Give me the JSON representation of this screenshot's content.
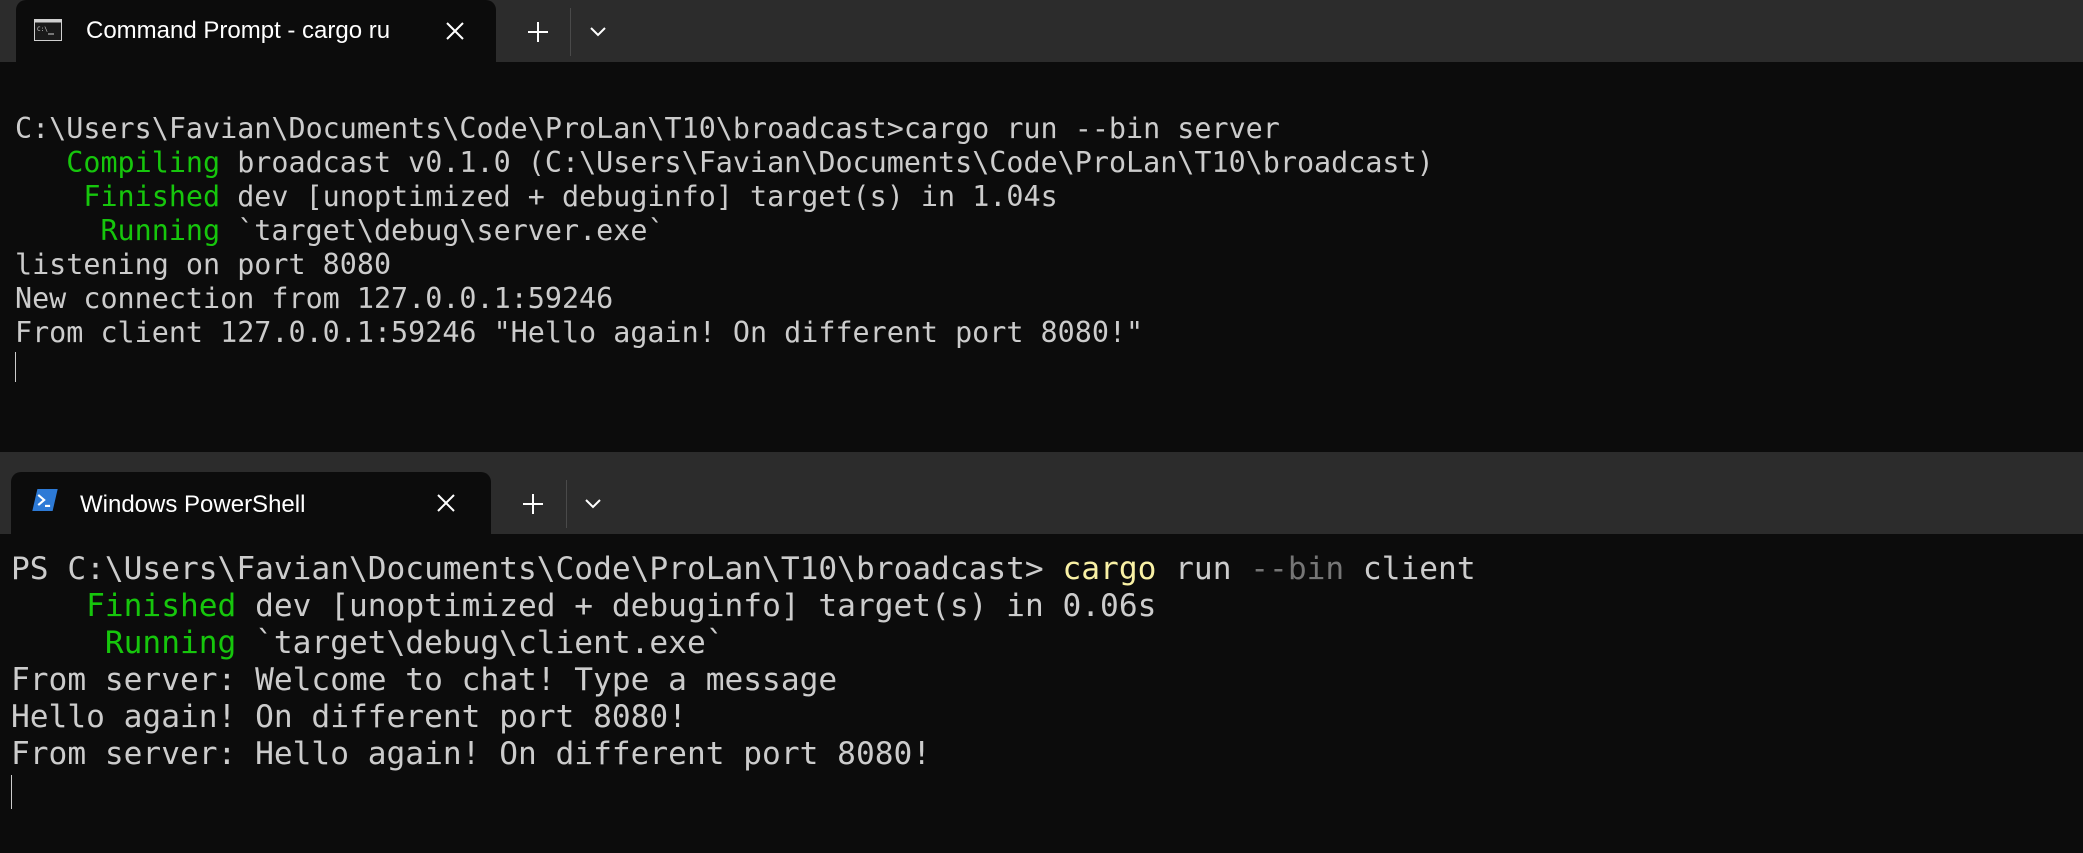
{
  "windows": {
    "top": {
      "tab": {
        "title": "Command Prompt - cargo  ru",
        "icon": "command-prompt-icon"
      },
      "lines": [
        {
          "segments": [
            {
              "text": "",
              "color": "default"
            }
          ]
        },
        {
          "segments": [
            {
              "text": "C:\\Users\\Favian\\Documents\\Code\\ProLan\\T10\\broadcast>cargo run --bin server",
              "color": "default"
            }
          ]
        },
        {
          "segments": [
            {
              "text": "   Compiling",
              "color": "green"
            },
            {
              "text": " broadcast v0.1.0 (C:\\Users\\Favian\\Documents\\Code\\ProLan\\T10\\broadcast)",
              "color": "default"
            }
          ]
        },
        {
          "segments": [
            {
              "text": "    Finished",
              "color": "green"
            },
            {
              "text": " dev [unoptimized + debuginfo] target(s) in 1.04s",
              "color": "default"
            }
          ]
        },
        {
          "segments": [
            {
              "text": "     Running",
              "color": "green"
            },
            {
              "text": " `target\\debug\\server.exe`",
              "color": "default"
            }
          ]
        },
        {
          "segments": [
            {
              "text": "listening on port 8080",
              "color": "default"
            }
          ]
        },
        {
          "segments": [
            {
              "text": "New connection from 127.0.0.1:59246",
              "color": "default"
            }
          ]
        },
        {
          "segments": [
            {
              "text": "From client 127.0.0.1:59246 \"Hello again! On different port 8080!\"",
              "color": "default"
            }
          ]
        }
      ]
    },
    "bottom": {
      "tab": {
        "title": "Windows PowerShell",
        "icon": "powershell-icon"
      },
      "lines": [
        {
          "segments": [
            {
              "text": "PS C:\\Users\\Favian\\Documents\\Code\\ProLan\\T10\\broadcast> ",
              "color": "default"
            },
            {
              "text": "cargo",
              "color": "yellow"
            },
            {
              "text": " run ",
              "color": "default"
            },
            {
              "text": "--bin",
              "color": "gray"
            },
            {
              "text": " client",
              "color": "default"
            }
          ]
        },
        {
          "segments": [
            {
              "text": "    Finished",
              "color": "green"
            },
            {
              "text": " dev [unoptimized + debuginfo] target(s) in 0.06s",
              "color": "default"
            }
          ]
        },
        {
          "segments": [
            {
              "text": "     Running",
              "color": "green"
            },
            {
              "text": " `target\\debug\\client.exe`",
              "color": "default"
            }
          ]
        },
        {
          "segments": [
            {
              "text": "From server: Welcome to chat! Type a message",
              "color": "default"
            }
          ]
        },
        {
          "segments": [
            {
              "text": "Hello again! On different port 8080!",
              "color": "default"
            }
          ]
        },
        {
          "segments": [
            {
              "text": "From server: Hello again! On different port 8080!",
              "color": "default"
            }
          ]
        }
      ]
    }
  },
  "colors": {
    "background": "#0c0c0c",
    "tabbar": "#2c2c2c",
    "default_text": "#cccccc",
    "green": "#16c60c",
    "yellow": "#f9f1a5",
    "gray": "#767676"
  }
}
